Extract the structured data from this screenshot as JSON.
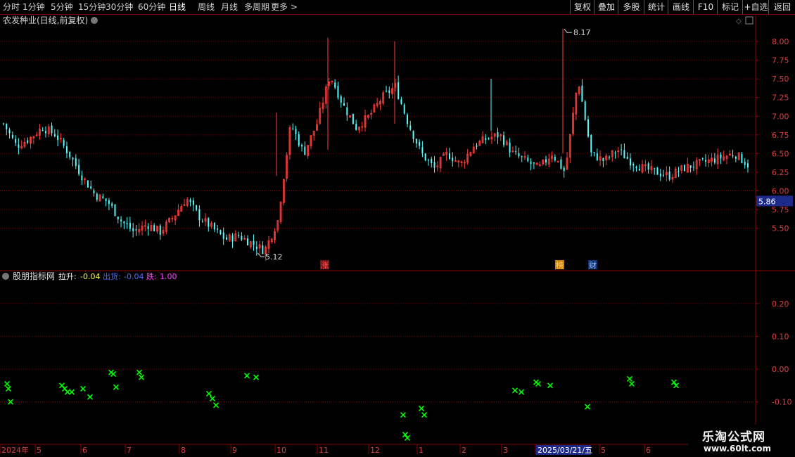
{
  "toolbar": {
    "periods": [
      "分时",
      "1分钟",
      "5分钟",
      "15分钟",
      "30分钟",
      "60分钟",
      "日线",
      "周线",
      "月线",
      "多周期",
      "更多 >"
    ],
    "active_period": "日线",
    "right_buttons": [
      "复权",
      "叠加",
      "多股",
      "统计",
      "画线",
      "F10",
      "标记",
      "+自选",
      "返回"
    ]
  },
  "main_panel": {
    "title": "农发种业(日线,前复权)",
    "price_axis": [
      "8.00",
      "7.75",
      "7.50",
      "7.25",
      "7.00",
      "6.75",
      "6.50",
      "6.25",
      "6.00",
      "5.75",
      "5.50"
    ],
    "current_price": "5.86",
    "high_label": "8.17",
    "low_label": "5.12",
    "event_markers": [
      "涨",
      "榜",
      "财"
    ]
  },
  "indicator_panel": {
    "name": "股朋指标网",
    "label_rise": "拉升:",
    "value_rise": "-0.04",
    "label_ship": "出货:",
    "value_ship": "-0.04",
    "label_fall": "跌:",
    "value_fall": "1.00",
    "axis": [
      "0.20",
      "0.10",
      "0.00",
      "-0.10"
    ]
  },
  "time_axis": {
    "labels": [
      "2024年",
      "5",
      "6",
      "7",
      "8",
      "9",
      "10",
      "11",
      "12",
      "1",
      "2",
      "3",
      "2025/03/21/五",
      "5",
      "6"
    ]
  },
  "watermark": {
    "line1": "乐淘公式网",
    "line2": "www.60lt.com"
  },
  "colors": {
    "up": "#ff3c3c",
    "down": "#54fcfc",
    "grid": "#8b0000",
    "marker": "#00ff00"
  },
  "chart_data": {
    "type": "candlestick",
    "title": "农发种业(日线,前复权)",
    "y_range": [
      5.12,
      8.17
    ],
    "high": 8.17,
    "low": 5.12,
    "last": 5.86,
    "close_trend": [
      6.9,
      6.6,
      6.7,
      6.85,
      6.75,
      6.5,
      6.2,
      5.95,
      5.85,
      5.6,
      5.45,
      5.55,
      5.45,
      5.65,
      5.9,
      5.65,
      5.5,
      5.35,
      5.4,
      5.3,
      5.2,
      5.6,
      6.9,
      6.5,
      6.9,
      7.55,
      7.15,
      6.85,
      7.0,
      7.25,
      7.4,
      6.9,
      6.5,
      6.3,
      6.5,
      6.35,
      6.6,
      6.7,
      6.75,
      6.5,
      6.4,
      6.3,
      6.5,
      6.25,
      7.5,
      6.5,
      6.4,
      6.55,
      6.4,
      6.3,
      6.25,
      6.2,
      6.3,
      6.35,
      6.4,
      6.45,
      6.5,
      6.35
    ],
    "indicator_points": [
      -0.045,
      -0.06,
      -0.1,
      -0.05,
      -0.06,
      -0.07,
      -0.07,
      -0.06,
      -0.085,
      -0.01,
      -0.015,
      -0.055,
      -0.01,
      -0.025,
      -0.075,
      -0.09,
      -0.11,
      -0.02,
      -0.025,
      -0.14,
      -0.2,
      -0.21,
      -0.12,
      -0.14,
      -0.065,
      -0.07,
      -0.04,
      -0.045,
      -0.05,
      -0.115,
      -0.03,
      -0.045,
      -0.04,
      -0.05
    ]
  }
}
